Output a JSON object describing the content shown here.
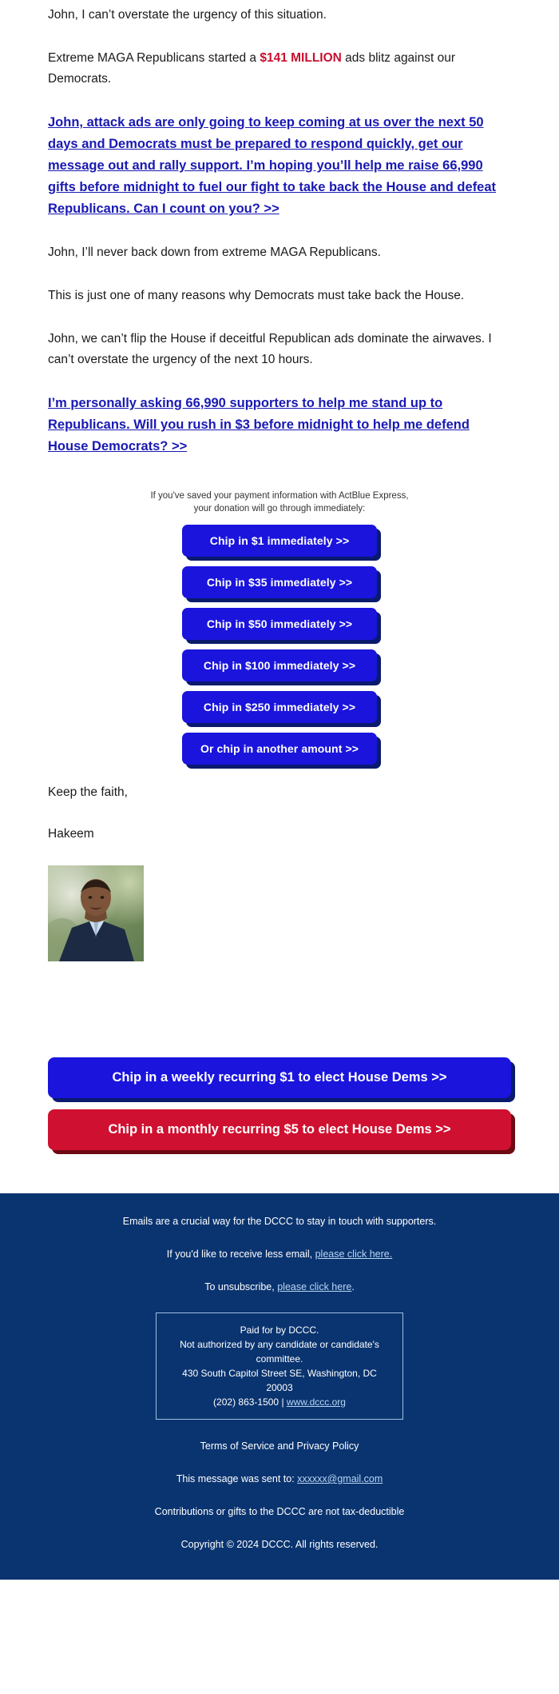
{
  "email": {
    "paragraphs": {
      "p1": "John, I can’t overstate the urgency of this situation.",
      "p2_before": "Extreme MAGA Republicans started a ",
      "p2_amount": "$141 MILLION",
      "p2_after": " ads blitz against our Democrats.",
      "link1": "John, attack ads are only going to keep coming at us over the next 50 days and Democrats must be prepared to respond quickly, get our message out and rally support. I’m hoping you’ll help me raise 66,990 gifts before midnight to fuel our fight to take back the House and defeat Republicans. Can I count on you? >>",
      "p3": "John, I’ll never back down from extreme MAGA Republicans.",
      "p4": "This is just one of many reasons why Democrats must take back the House.",
      "p5": "John, we can’t flip the House if deceitful Republican ads dominate the airwaves. I can’t overstate the urgency of the next 10 hours.",
      "link2": "I’m personally asking 66,990 supporters to help me stand up to Republicans. Will you rush in $3 before midnight to help me defend House Democrats? >>",
      "signoff": "Keep the faith,",
      "signer": "Hakeem"
    },
    "actblue_note_line1": "If you've saved your payment information with ActBlue Express,",
    "actblue_note_line2": "your donation will go through immediately:",
    "chip_buttons": [
      "Chip in $1 immediately >>",
      "Chip in $35 immediately >>",
      "Chip in $50 immediately >>",
      "Chip in $100 immediately >>",
      "Chip in $250 immediately >>",
      "Or chip in another amount >>"
    ],
    "recurring_buttons": [
      "Chip in a weekly recurring $1 to elect House Dems >>",
      "Chip in a monthly recurring $5 to elect House Dems >>"
    ]
  },
  "footer": {
    "line1": "Emails are a crucial way for the DCCC to stay in touch with supporters.",
    "line2_before": "If you'd like to receive less email, ",
    "line2_link": "please click here.",
    "line3_before": "To unsubscribe, ",
    "line3_link": "please click here",
    "line3_after": ".",
    "paid_for": {
      "l1": "Paid for by DCCC.",
      "l2": "Not authorized by any candidate or candidate's committee.",
      "l3": "430 South Capitol Street SE, Washington, DC 20003",
      "l4_phone": "(202) 863-1500 | ",
      "l4_link": "www.dccc.org"
    },
    "terms": "Terms of Service and Privacy Policy",
    "sent_to_before": "This message was sent to: ",
    "sent_to_email": "xxxxxx@gmail.com",
    "tax": "Contributions or gifts to the DCCC are not tax-deductible",
    "copyright": "Copyright © 2024 DCCC. All rights reserved."
  },
  "colors": {
    "link_blue": "#1919b3",
    "accent_red": "#c8102e",
    "button_blue": "#1a14dd",
    "button_red": "#d01030",
    "footer_bg": "#0a3470"
  }
}
